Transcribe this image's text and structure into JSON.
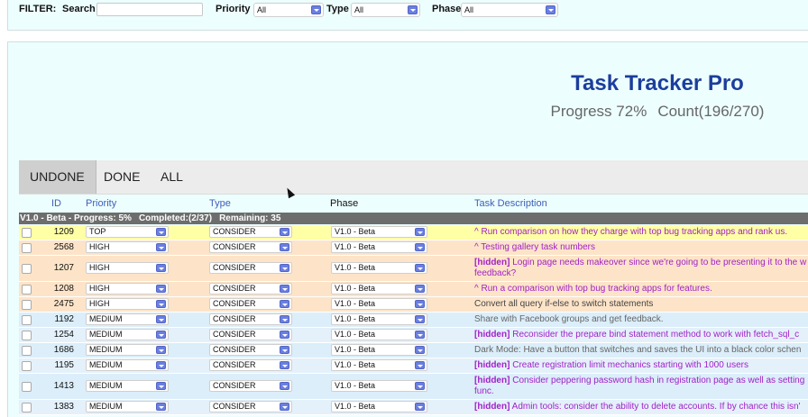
{
  "filter": {
    "label": "FILTER:",
    "search_label": "Search",
    "search_value": "",
    "priority_label": "Priority",
    "priority_value": "All",
    "type_label": "Type",
    "type_value": "All",
    "phase_label": "Phase",
    "phase_value": "All"
  },
  "header": {
    "title": "Task Tracker Pro",
    "progress": "Progress 72%",
    "count": "Count(196/270)"
  },
  "tabs": [
    {
      "label": "UNDONE",
      "active": true
    },
    {
      "label": "DONE",
      "active": false
    },
    {
      "label": "ALL",
      "active": false
    }
  ],
  "columns": {
    "id": "ID",
    "priority": "Priority",
    "type": "Type",
    "phase": "Phase",
    "description": "Task Description"
  },
  "group": {
    "name": "V1.0 - Beta - Progress: 5%",
    "completed": "Completed:(2/37)",
    "remaining": "Remaining: 35"
  },
  "rows": [
    {
      "id": "1209",
      "priority": "TOP",
      "type": "CONSIDER",
      "phase": "V1.0 - Beta",
      "hidden": "",
      "text": "^ Run comparison on how they charge with top bug tracking apps and rank us."
    },
    {
      "id": "2568",
      "priority": "HIGH",
      "type": "CONSIDER",
      "phase": "V1.0 - Beta",
      "hidden": "",
      "text": "^ Testing gallery task numbers"
    },
    {
      "id": "1207",
      "priority": "HIGH",
      "type": "CONSIDER",
      "phase": "V1.0 - Beta",
      "hidden": "[hidden]",
      "text": "Login page needs makeover since we're going to be presenting it to the w",
      "text2": "feedback?"
    },
    {
      "id": "1208",
      "priority": "HIGH",
      "type": "CONSIDER",
      "phase": "V1.0 - Beta",
      "hidden": "",
      "text": "^ Run a comparison with top bug tracking apps for features."
    },
    {
      "id": "2475",
      "priority": "HIGH",
      "type": "CONSIDER",
      "phase": "V1.0 - Beta",
      "hidden": "",
      "text": "Convert all query if-else to switch statements"
    },
    {
      "id": "1192",
      "priority": "MEDIUM",
      "type": "CONSIDER",
      "phase": "V1.0 - Beta",
      "hidden": "",
      "text": "Share with Facebook groups and get feedback."
    },
    {
      "id": "1254",
      "priority": "MEDIUM",
      "type": "CONSIDER",
      "phase": "V1.0 - Beta",
      "hidden": "[hidden]",
      "text": "Reconsider the prepare bind statement method to work with fetch_sql_c"
    },
    {
      "id": "1686",
      "priority": "MEDIUM",
      "type": "CONSIDER",
      "phase": "V1.0 - Beta",
      "hidden": "",
      "text": "Dark Mode: Have a button that switches and saves the UI into a black color schen"
    },
    {
      "id": "1195",
      "priority": "MEDIUM",
      "type": "CONSIDER",
      "phase": "V1.0 - Beta",
      "hidden": "[hidden]",
      "text": "Create registration limit mechanics starting with 1000 users"
    },
    {
      "id": "1413",
      "priority": "MEDIUM",
      "type": "CONSIDER",
      "phase": "V1.0 - Beta",
      "hidden": "[hidden]",
      "text": "Consider peppering password hash in registration page as well as setting",
      "text2": "func."
    },
    {
      "id": "1383",
      "priority": "MEDIUM",
      "type": "CONSIDER",
      "phase": "V1.0 - Beta",
      "hidden": "[hidden]",
      "text": "Admin tools: consider the ability to delete accounts. If by chance this isn'"
    }
  ],
  "colors": {
    "title": "#1b3e9c",
    "top_row": "#ffffa6",
    "high_row": "#fde4c8",
    "medium_row": "#dbeefa",
    "hidden_text": "#a121c7",
    "group_bar": "#6d6d6d"
  }
}
